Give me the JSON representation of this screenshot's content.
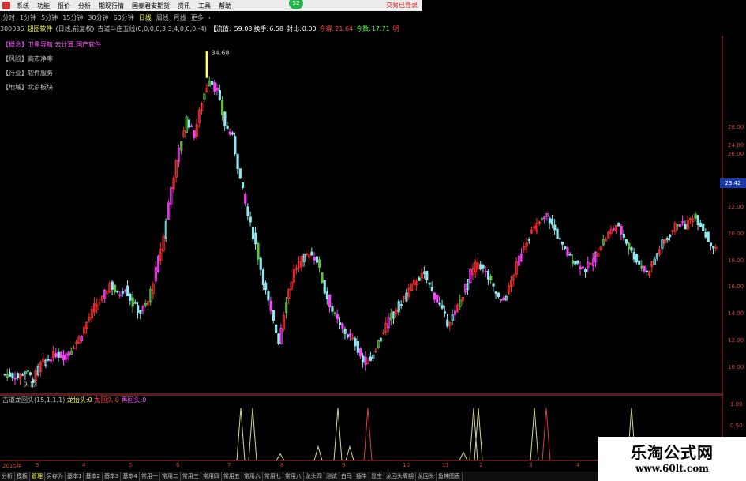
{
  "menu": {
    "items": [
      "系统",
      "功能",
      "报价",
      "分析",
      "期现行情",
      "国泰君安期货",
      "资讯",
      "工具",
      "帮助"
    ],
    "badge": "52",
    "trade_login": "交易已登录"
  },
  "period_tabs": [
    "分时",
    "1分钟",
    "5分钟",
    "15分钟",
    "30分钟",
    "60分钟",
    "日线",
    "周线",
    "月线",
    "更多"
  ],
  "period_active": "日线",
  "info_bar": {
    "code": "300036",
    "name": "超图软件",
    "mode": "(日线,前复权)",
    "indicator": "古道斗庄五线(0,0,0,0,3,3,4,0,0,0,-4)",
    "float_label": "【流值:",
    "float_value": "59.03",
    "turnover_label": "换手:",
    "turnover_value": "6.58",
    "ratio_label": "封比:",
    "ratio_value": "0.00",
    "today_get_label": "今得:",
    "today_get_value": "21.64",
    "today_days_label": "今数:",
    "today_days_value": "17.71",
    "extra": "明"
  },
  "tags": [
    {
      "key": "【概念】",
      "value": "卫星导航 云计算 国产软件"
    },
    {
      "key": "【风险】",
      "value": "高市净率"
    },
    {
      "key": "【行业】",
      "value": "软件服务"
    },
    {
      "key": "【地域】",
      "value": "北京板块"
    }
  ],
  "main_high_label": "34.68",
  "main_low_label": "9.13",
  "price_tag": "23.42",
  "y_ticks": [
    "28.00",
    "26.00",
    "24.00",
    "22.00",
    "20.00",
    "18.00",
    "16.00",
    "14.00",
    "12.00",
    "10.00"
  ],
  "sub_indicator": {
    "name": "古道龙回头(15,1,1,1)",
    "a_label": "龙抬头:",
    "a_value": "0",
    "b_label": "龙回头:",
    "b_value": "0",
    "c_label": "再回头:",
    "c_value": "0"
  },
  "sub_ticks": [
    "1.00",
    "0.50"
  ],
  "month_labels": [
    "2015年",
    "3",
    "4",
    "5",
    "6",
    "7",
    "8",
    "9",
    "10",
    "11",
    "2",
    "3",
    "4"
  ],
  "bottom_tabs": [
    "分析",
    "模板",
    "管理",
    "另存为",
    "基本1",
    "基本2",
    "基本3",
    "基本4",
    "常用一",
    "常用二",
    "常用三",
    "常用四",
    "常用五",
    "常用六",
    "常用七",
    "常用八",
    "龙头四",
    "测试",
    "白马",
    "插牛",
    "显庄",
    "龙回头周期",
    "龙回头",
    "鱼神图表"
  ],
  "bottom_tab_active": "管理",
  "watermark": {
    "title": "乐淘公式网",
    "url": "www.60lt.com"
  },
  "colors": {
    "up": "#ff3030",
    "magenta": "#ff40ff",
    "cyan": "#8fe8f0",
    "green": "#60c040",
    "yellow": "#ffff60",
    "axis_red": "#c03030"
  },
  "chart_data": {
    "type": "candlestick",
    "y_range": [
      9,
      29.5
    ],
    "high": 34.68,
    "low": 9.13,
    "closes": [
      9.8,
      9.6,
      10.1,
      9.4,
      10.6,
      11.0,
      11.4,
      11.2,
      11.8,
      12.6,
      13.8,
      15.0,
      15.6,
      16.8,
      15.9,
      16.5,
      15.2,
      14.6,
      15.4,
      17.8,
      20.4,
      24.2,
      27.0,
      29.5,
      28.2,
      30.8,
      32.6,
      31.5,
      29.0,
      28.0,
      24.8,
      22.0,
      19.8,
      17.0,
      14.5,
      12.4,
      15.6,
      17.8,
      18.6,
      19.2,
      18.6,
      16.2,
      14.7,
      13.5,
      12.8,
      12.2,
      10.8,
      11.0,
      12.3,
      13.6,
      14.6,
      15.4,
      16.3,
      17.1,
      17.5,
      16.2,
      15.1,
      13.8,
      14.5,
      16.0,
      17.6,
      18.4,
      17.6,
      16.4,
      15.3,
      16.4,
      18.2,
      19.8,
      20.8,
      21.5,
      22.0,
      20.9,
      19.6,
      18.8,
      18.3,
      17.9,
      18.6,
      19.8,
      20.6,
      21.3,
      20.4,
      19.2,
      18.3,
      17.6,
      18.7,
      19.9,
      20.6,
      21.5,
      21.2,
      22.0,
      21.4,
      20.1,
      19.4
    ]
  }
}
